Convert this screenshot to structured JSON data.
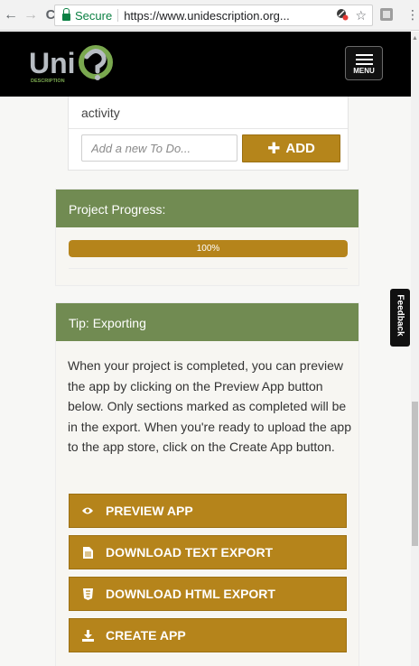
{
  "browser": {
    "back_icon": "←",
    "forward_icon": "→",
    "reload_icon": "C",
    "secure_label": "Secure",
    "url": "https://www.unidescription.org...",
    "star_icon": "☆",
    "menu_icon": "⋮"
  },
  "header": {
    "logo_text": "Uni",
    "logo_sub": "DESCRIPTION",
    "menu_label": "MENU"
  },
  "todo": {
    "item_text": "activity",
    "input_placeholder": "Add a new To Do...",
    "add_label": "ADD"
  },
  "progress": {
    "title": "Project Progress:",
    "percent_label": "100%",
    "fraction": 1.0
  },
  "tip": {
    "title": "Tip: Exporting",
    "body": "When your project is completed, you can preview the app by clicking on the Preview App button below. Only sections marked as completed will be in the export. When you're ready to upload the app to the app store, click on the Create App button.",
    "buttons": [
      {
        "label": "PREVIEW APP",
        "icon": "eye-icon"
      },
      {
        "label": "DOWNLOAD TEXT EXPORT",
        "icon": "file-icon"
      },
      {
        "label": "DOWNLOAD HTML EXPORT",
        "icon": "html5-icon"
      },
      {
        "label": "CREATE APP",
        "icon": "download-icon"
      }
    ]
  },
  "feedback": {
    "label": "Feedback"
  },
  "colors": {
    "gold": "#b5841b",
    "green": "#718b52",
    "header_bg": "#000000"
  }
}
